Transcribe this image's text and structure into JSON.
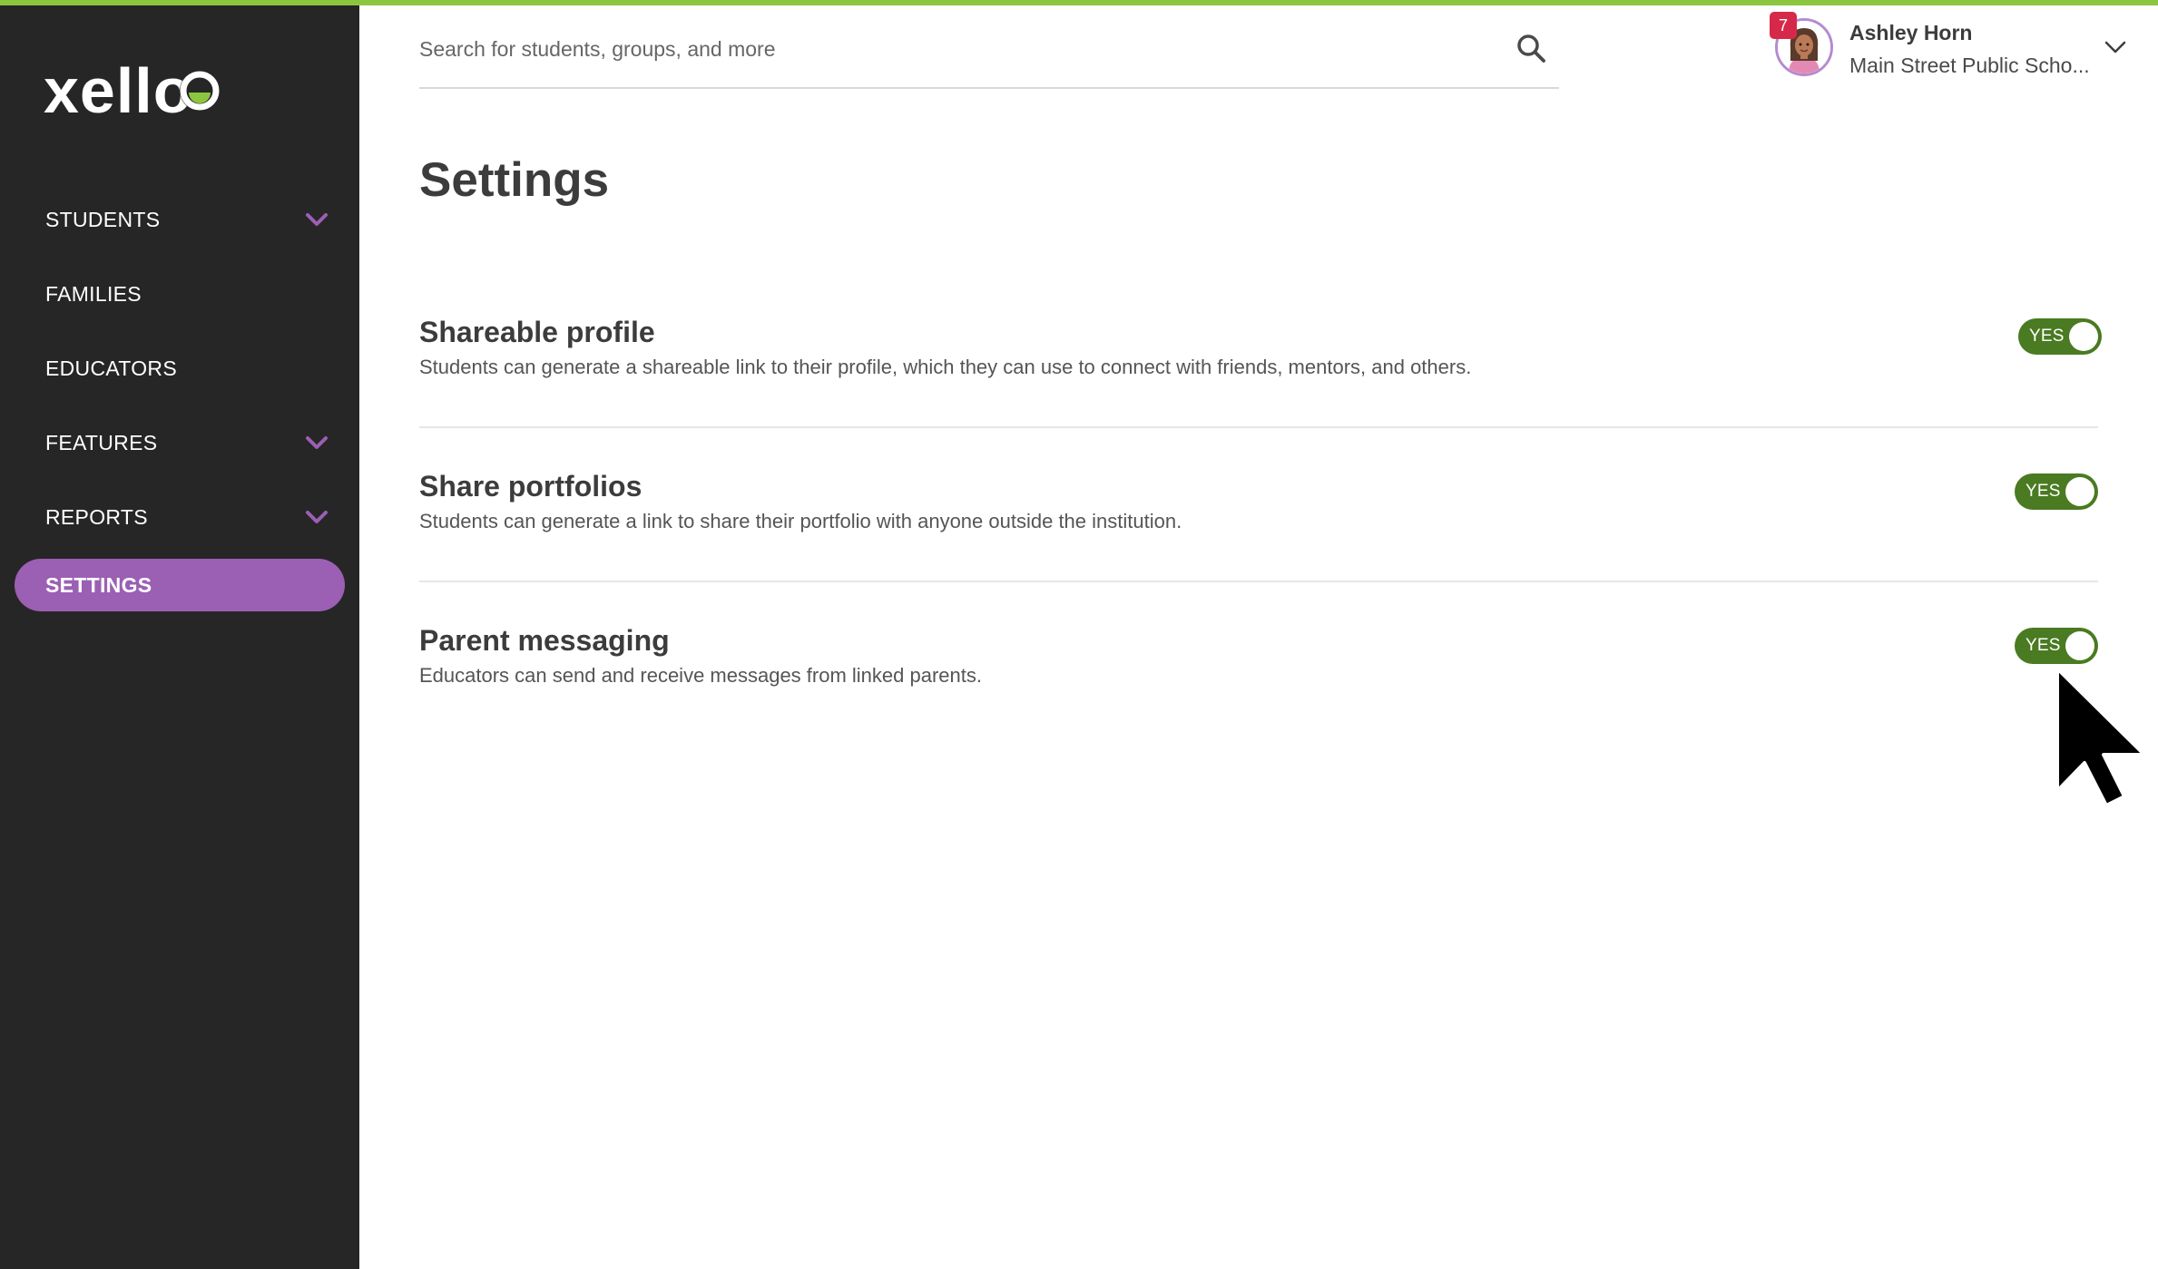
{
  "app": {
    "logo_text": "xello",
    "brand_colors": {
      "accent_green": "#8cc63f",
      "active_purple": "#9b5fb4",
      "toggle_green": "#4a7a21",
      "sidebar_bg": "#262626"
    }
  },
  "sidebar": {
    "items": [
      {
        "label": "STUDENTS",
        "has_chevron": true,
        "icon": "chevron-down-icon"
      },
      {
        "label": "FAMILIES",
        "has_chevron": false
      },
      {
        "label": "EDUCATORS",
        "has_chevron": false
      },
      {
        "label": "FEATURES",
        "has_chevron": true,
        "icon": "chevron-down-icon"
      },
      {
        "label": "REPORTS",
        "has_chevron": true,
        "icon": "chevron-down-icon"
      },
      {
        "label": "SETTINGS",
        "has_chevron": false,
        "active": true
      }
    ]
  },
  "header": {
    "search": {
      "placeholder": "Search for students, groups, and more",
      "icon": "search-icon"
    },
    "user": {
      "name": "Ashley Horn",
      "school": "Main Street Public Scho...",
      "notification_count": "7",
      "icon": "chevron-down-icon"
    }
  },
  "main": {
    "title": "Settings",
    "settings": [
      {
        "title": "Shareable profile",
        "description": "Students can generate a shareable link to their profile, which they can use to connect with friends, mentors, and others.",
        "toggle_label": "YES",
        "enabled": true
      },
      {
        "title": "Share portfolios",
        "description": "Students can generate a link to share their portfolio with anyone outside the institution.",
        "toggle_label": "YES",
        "enabled": true
      },
      {
        "title": "Parent messaging",
        "description": "Educators can send and receive messages from linked parents.",
        "toggle_label": "YES",
        "enabled": true
      }
    ]
  }
}
